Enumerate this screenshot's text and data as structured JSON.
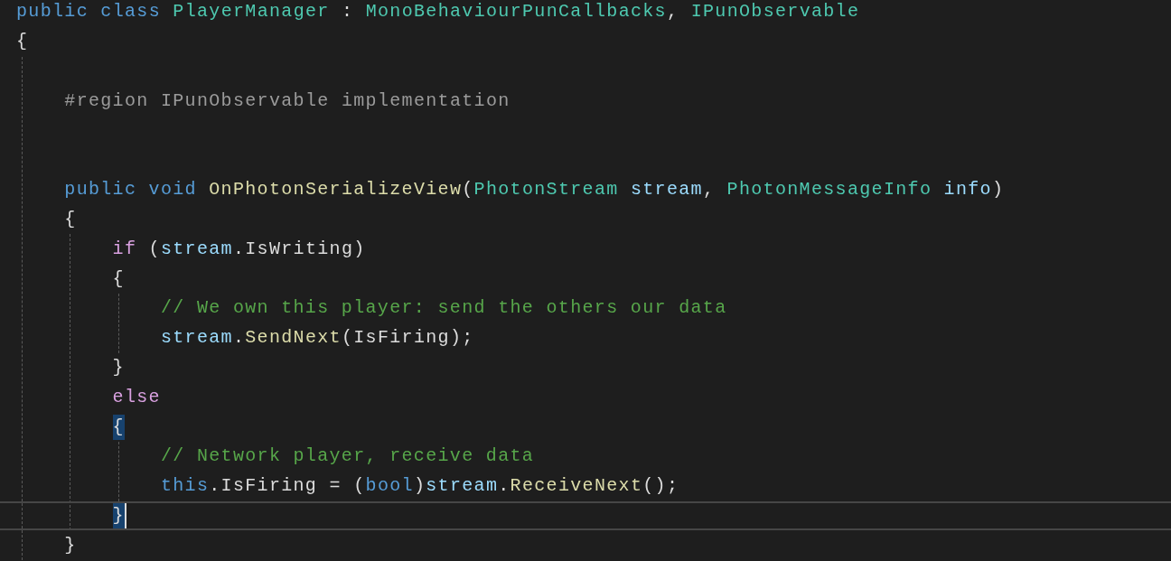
{
  "editor": {
    "lines": [
      {
        "kind": "code",
        "tokens": [
          {
            "kind": "keyword",
            "text": "public class "
          },
          {
            "kind": "type",
            "text": "PlayerManager"
          },
          {
            "kind": "plain",
            "text": " : "
          },
          {
            "kind": "type",
            "text": "MonoBehaviourPunCallbacks"
          },
          {
            "kind": "plain",
            "text": ", "
          },
          {
            "kind": "type",
            "text": "IPunObservable"
          }
        ]
      },
      {
        "kind": "code",
        "matched": false,
        "tokens": [
          {
            "kind": "plain",
            "text": "{"
          }
        ],
        "children": [
          {
            "kind": "blank"
          },
          {
            "kind": "code",
            "tokens": [
              {
                "kind": "preproc",
                "text": "#region IPunObservable implementation"
              }
            ]
          },
          {
            "kind": "blank"
          },
          {
            "kind": "blank"
          },
          {
            "kind": "code",
            "tokens": [
              {
                "kind": "keyword",
                "text": "public void "
              },
              {
                "kind": "method",
                "text": "OnPhotonSerializeView"
              },
              {
                "kind": "plain",
                "text": "("
              },
              {
                "kind": "type",
                "text": "PhotonStream "
              },
              {
                "kind": "param",
                "text": "stream"
              },
              {
                "kind": "plain",
                "text": ", "
              },
              {
                "kind": "type",
                "text": "PhotonMessageInfo "
              },
              {
                "kind": "param",
                "text": "info"
              },
              {
                "kind": "plain",
                "text": ")"
              }
            ]
          },
          {
            "kind": "code",
            "matched": false,
            "tokens": [
              {
                "kind": "plain",
                "text": "{"
              }
            ],
            "children": [
              {
                "kind": "code",
                "tokens": [
                  {
                    "kind": "control",
                    "text": "if"
                  },
                  {
                    "kind": "plain",
                    "text": " ("
                  },
                  {
                    "kind": "param",
                    "text": "stream"
                  },
                  {
                    "kind": "plain",
                    "text": ".IsWriting)"
                  }
                ]
              },
              {
                "kind": "code",
                "matched": false,
                "tokens": [
                  {
                    "kind": "plain",
                    "text": "{"
                  }
                ],
                "children": [
                  {
                    "kind": "code",
                    "tokens": [
                      {
                        "kind": "comment",
                        "text": "// We own this player: send the others our data"
                      }
                    ]
                  },
                  {
                    "kind": "code",
                    "tokens": [
                      {
                        "kind": "param",
                        "text": "stream"
                      },
                      {
                        "kind": "plain",
                        "text": "."
                      },
                      {
                        "kind": "method",
                        "text": "SendNext"
                      },
                      {
                        "kind": "plain",
                        "text": "(IsFiring);"
                      }
                    ]
                  }
                ]
              },
              {
                "kind": "code",
                "matched": false,
                "tokens": [
                  {
                    "kind": "plain",
                    "text": "}"
                  }
                ]
              },
              {
                "kind": "code",
                "tokens": [
                  {
                    "kind": "control",
                    "text": "else"
                  }
                ]
              },
              {
                "kind": "code",
                "matched": true,
                "tokens": [
                  {
                    "kind": "plain",
                    "text": "{"
                  }
                ],
                "children": [
                  {
                    "kind": "code",
                    "tokens": [
                      {
                        "kind": "comment",
                        "text": "// Network player, receive data"
                      }
                    ]
                  },
                  {
                    "kind": "code",
                    "tokens": [
                      {
                        "kind": "keyword",
                        "text": "this"
                      },
                      {
                        "kind": "plain",
                        "text": ".IsFiring = ("
                      },
                      {
                        "kind": "keyword",
                        "text": "bool"
                      },
                      {
                        "kind": "plain",
                        "text": ")"
                      },
                      {
                        "kind": "param",
                        "text": "stream"
                      },
                      {
                        "kind": "plain",
                        "text": "."
                      },
                      {
                        "kind": "method",
                        "text": "ReceiveNext"
                      },
                      {
                        "kind": "plain",
                        "text": "();"
                      }
                    ]
                  }
                ]
              },
              {
                "kind": "code",
                "matched": true,
                "current": true,
                "tokens": [
                  {
                    "kind": "plain",
                    "text": "}"
                  }
                ]
              }
            ]
          },
          {
            "kind": "code",
            "matched": false,
            "tokens": [
              {
                "kind": "plain",
                "text": "}"
              }
            ]
          }
        ]
      }
    ]
  }
}
